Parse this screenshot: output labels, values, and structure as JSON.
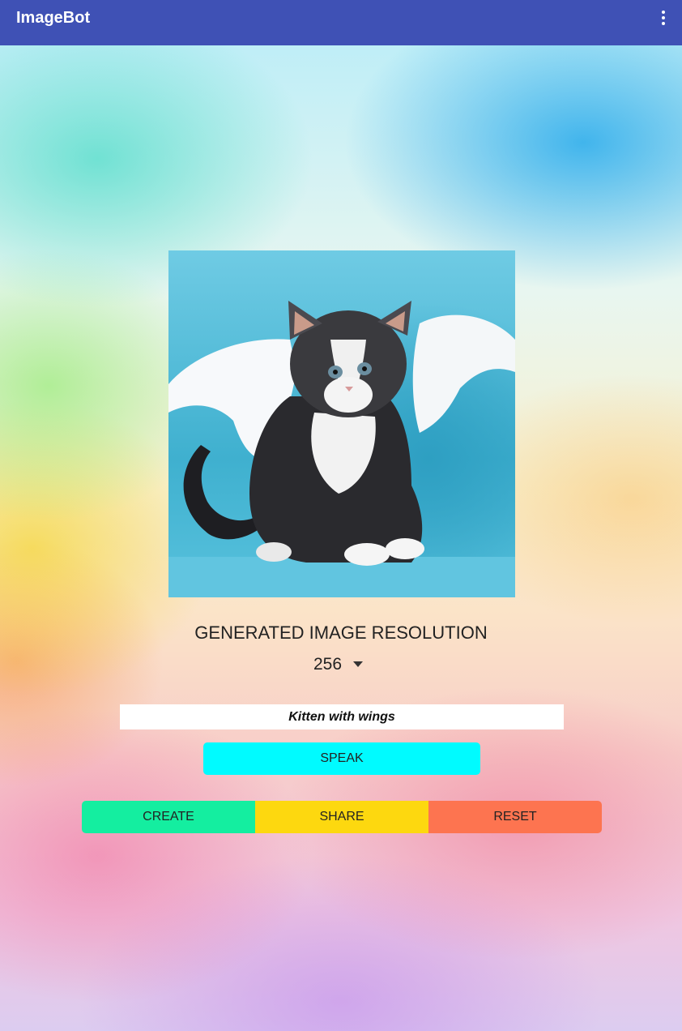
{
  "app_bar": {
    "title": "ImageBot",
    "color": "#3f51b5",
    "overflow_icon": "more-vert-icon"
  },
  "generated_image": {
    "icon": "kitten-with-wings-image"
  },
  "resolution": {
    "label": "GENERATED IMAGE RESOLUTION",
    "selected": "256",
    "dropdown_icon": "dropdown-arrow-icon"
  },
  "prompt": {
    "value": "Kitten with wings"
  },
  "buttons": {
    "speak": "SPEAK",
    "create": "CREATE",
    "share": "SHARE",
    "reset": "RESET"
  },
  "colors": {
    "speak": "#00fbff",
    "create": "#14eea0",
    "share": "#fdd80f",
    "reset": "#fd7450"
  }
}
